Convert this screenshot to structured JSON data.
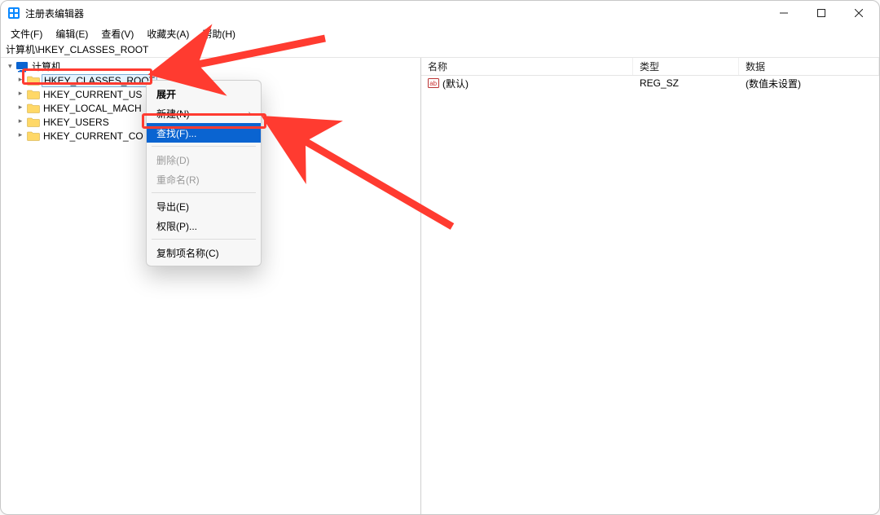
{
  "app": {
    "title": "注册表编辑器",
    "address": "计算机\\HKEY_CLASSES_ROOT"
  },
  "menubar": {
    "file": "文件(F)",
    "edit": "编辑(E)",
    "view": "查看(V)",
    "favorites": "收藏夹(A)",
    "help": "帮助(H)"
  },
  "tree": {
    "root": "计算机",
    "items": [
      {
        "label": "HKEY_CLASSES_ROOT",
        "selected": true
      },
      {
        "label": "HKEY_CURRENT_US"
      },
      {
        "label": "HKEY_LOCAL_MACH"
      },
      {
        "label": "HKEY_USERS"
      },
      {
        "label": "HKEY_CURRENT_CO"
      }
    ]
  },
  "list": {
    "headers": {
      "name": "名称",
      "type": "类型",
      "data": "数据"
    },
    "rows": [
      {
        "name": "(默认)",
        "type": "REG_SZ",
        "data": "(数值未设置)"
      }
    ]
  },
  "context_menu": {
    "expand": "展开",
    "new": "新建(N)",
    "find": "查找(F)...",
    "delete": "删除(D)",
    "rename": "重命名(R)",
    "export": "导出(E)",
    "permissions": "权限(P)...",
    "copy_key_name": "复制项名称(C)",
    "submenu_marker": "›"
  },
  "icons": {
    "app": "app-icon",
    "minimize": "minimize-icon",
    "maximize": "maximize-icon",
    "close": "close-icon",
    "chevron_right": "chevron-right-icon",
    "chevron_down": "chevron-down-icon",
    "folder": "folder-icon",
    "computer": "computer-icon",
    "reg_string": "reg-string-icon"
  },
  "colors": {
    "accent": "#0a64d1",
    "annotation": "#ff3b30",
    "folder": "#ffd867"
  }
}
